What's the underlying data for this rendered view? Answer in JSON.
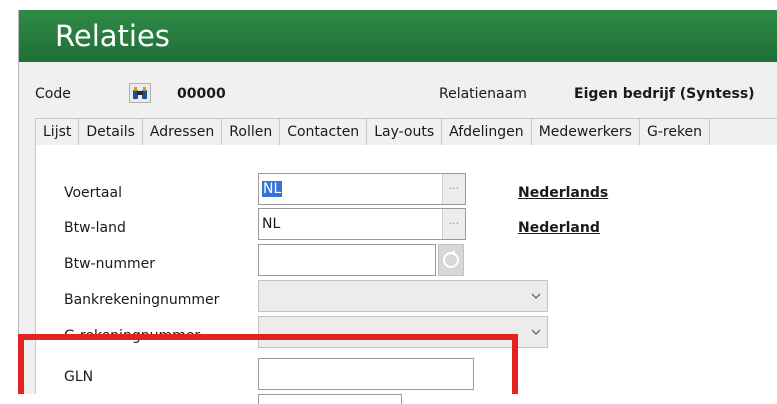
{
  "window": {
    "title": "Relaties"
  },
  "header": {
    "code_label": "Code",
    "code_value": "00000",
    "relname_label": "Relatienaam",
    "relname_value": "Eigen bedrijf (Syntess)"
  },
  "tabs": [
    {
      "label": "Lijst"
    },
    {
      "label": "Details"
    },
    {
      "label": "Adressen"
    },
    {
      "label": "Rollen"
    },
    {
      "label": "Contacten"
    },
    {
      "label": "Lay-outs"
    },
    {
      "label": "Afdelingen"
    },
    {
      "label": "Medewerkers"
    },
    {
      "label": "G-reken"
    }
  ],
  "form": {
    "voertaal": {
      "label": "Voertaal",
      "value": "NL",
      "lookup_label": "Nederlands"
    },
    "btw_land": {
      "label": "Btw-land",
      "value": "NL",
      "lookup_label": "Nederland"
    },
    "btw_nummer": {
      "label": "Btw-nummer",
      "value": ""
    },
    "bankrekening": {
      "label": "Bankrekeningnummer",
      "value": ""
    },
    "g_rekening": {
      "label": "G-rekeningnummer",
      "value": ""
    },
    "gln": {
      "label": "GLN",
      "value": ""
    }
  },
  "highlight": {
    "color": "#e3231f"
  },
  "colors": {
    "title_bar": "#1f6f35",
    "selection": "#3374d6"
  }
}
